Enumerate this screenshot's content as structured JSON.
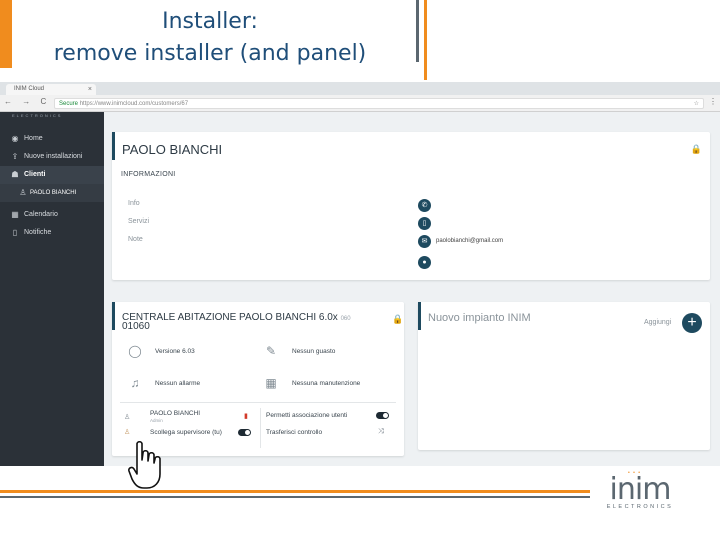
{
  "slide": {
    "title_line1": "Installer:",
    "title_line2": "remove installer (and panel)"
  },
  "browser": {
    "tab_title": "INIM Cloud",
    "tab_close": "×",
    "secure_label": "Secure",
    "url": "https://www.inimcloud.com/customers/67",
    "nav": "← → C"
  },
  "sidebar": {
    "brand": "ELECTRONICS",
    "items": [
      {
        "label": "Home",
        "icon": "dashboard-icon"
      },
      {
        "label": "Nuove installazioni",
        "icon": "new-install-icon"
      },
      {
        "label": "Clienti",
        "icon": "users-icon"
      },
      {
        "label": "PAOLO BIANCHI",
        "icon": "user-icon"
      },
      {
        "label": "Calendario",
        "icon": "calendar-icon"
      },
      {
        "label": "Notifiche",
        "icon": "phone-icon"
      }
    ]
  },
  "customer": {
    "name": "PAOLO BIANCHI",
    "section": "INFORMAZIONI",
    "fields": [
      "Info",
      "Servizi",
      "Note"
    ],
    "email": "paolobianchi@gmail.com"
  },
  "panel": {
    "title": "CENTRALE ABITAZIONE PAOLO BIANCHI 6.0x",
    "title_overflow": "01060",
    "serial": "060",
    "version": "Versione 6.03",
    "faults": "Nessun guasto",
    "alarms": "Nessun allarme",
    "maintenance": "Nessuna manutenzione",
    "installer_name": "PAOLO BIANCHI",
    "installer_role": "Admin",
    "perm_label": "Permetti associazione utenti",
    "supervisor_label": "Scollega supervisore (tu)",
    "transfer_label": "Trasferisci controllo"
  },
  "new_system": {
    "title": "Nuovo impianto INIM",
    "add_label": "Aggiungi",
    "add_symbol": "+"
  },
  "logo": {
    "word": "inim",
    "sub": "ELECTRONICS"
  },
  "colors": {
    "accent_orange": "#f08c1e",
    "dark_teal": "#1e4a5f",
    "sidebar_bg": "#2b3138",
    "title_blue": "#1f4e79"
  }
}
